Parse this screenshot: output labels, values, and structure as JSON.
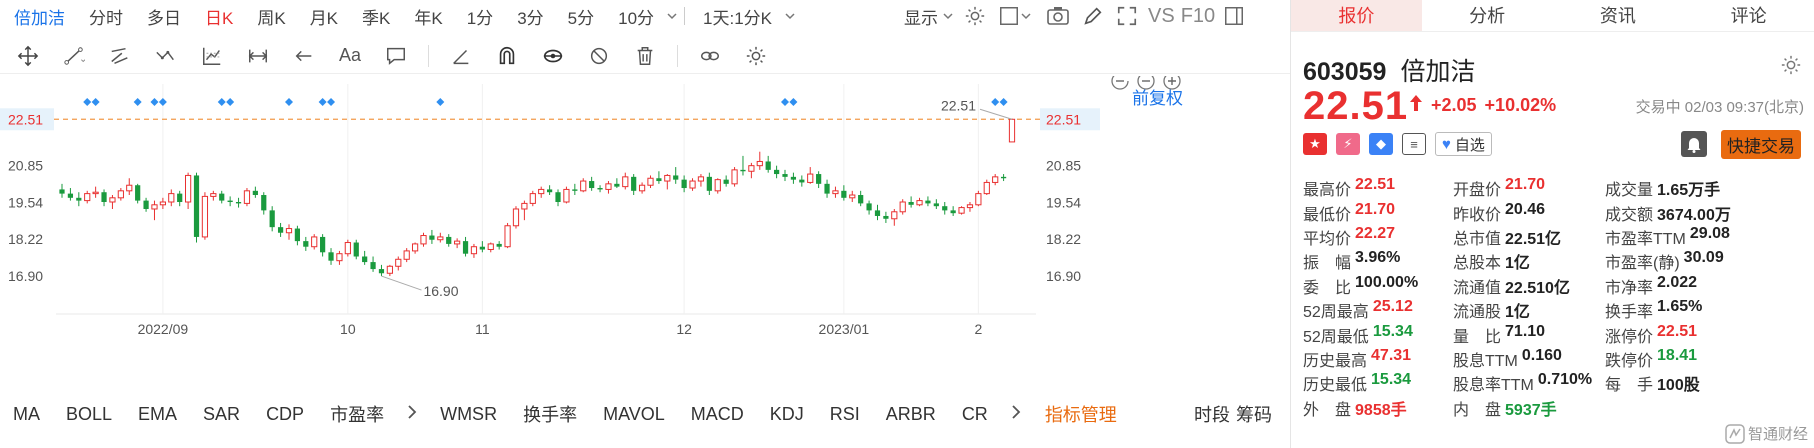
{
  "periods": [
    "倍加洁",
    "分时",
    "多日",
    "日K",
    "周K",
    "月K",
    "季K",
    "年K",
    "1分",
    "3分",
    "5分",
    "10分"
  ],
  "active_period": "日K",
  "period_dropdown": "1天:1分K",
  "display_label": "显示",
  "vs_label": "VS",
  "f10_label": "F10",
  "tools": [
    "crosshair-icon",
    "line-tool-icon",
    "channel-tool-icon",
    "wave-tool-icon",
    "fib-tool-icon",
    "range-tool-icon",
    "arrow-tool-icon",
    "text-tool-icon",
    "note-tool-icon",
    "angle-tool-icon",
    "magnet-icon",
    "eye-icon",
    "hide-icon",
    "trash-icon",
    "link-icon",
    "settings-icon"
  ],
  "text_tool_label": "Aa",
  "restore_label": "前复权",
  "chart_data": {
    "type": "candlestick",
    "title": "",
    "ylim": [
      15.9,
      23.2
    ],
    "yticks": [
      22.51,
      20.85,
      19.54,
      18.22,
      16.9
    ],
    "xticks": [
      "2022/09",
      "10",
      "11",
      "12",
      "2023/01",
      "2"
    ],
    "xtick_index": [
      12,
      34,
      50,
      74,
      93,
      109
    ],
    "current_price_line": 22.51,
    "max_label": "22.51",
    "min_label": "16.90",
    "candles": [
      [
        20.0,
        20.2,
        19.7,
        19.85
      ],
      [
        19.85,
        20.05,
        19.6,
        19.7
      ],
      [
        19.7,
        19.9,
        19.4,
        19.6
      ],
      [
        19.6,
        19.95,
        19.5,
        19.85
      ],
      [
        19.85,
        20.1,
        19.7,
        19.9
      ],
      [
        19.9,
        20.0,
        19.4,
        19.55
      ],
      [
        19.55,
        19.8,
        19.3,
        19.7
      ],
      [
        19.7,
        20.05,
        19.6,
        19.95
      ],
      [
        19.95,
        20.4,
        19.8,
        20.15
      ],
      [
        20.15,
        20.2,
        19.5,
        19.6
      ],
      [
        19.6,
        19.7,
        19.2,
        19.3
      ],
      [
        19.3,
        19.6,
        18.9,
        19.45
      ],
      [
        19.45,
        19.7,
        19.3,
        19.55
      ],
      [
        19.55,
        20.0,
        19.4,
        19.85
      ],
      [
        19.85,
        19.95,
        19.4,
        19.55
      ],
      [
        19.55,
        20.6,
        19.3,
        20.5
      ],
      [
        20.5,
        20.6,
        18.1,
        18.3
      ],
      [
        18.3,
        19.9,
        18.2,
        19.75
      ],
      [
        19.75,
        19.95,
        19.6,
        19.85
      ],
      [
        19.85,
        19.95,
        19.5,
        19.6
      ],
      [
        19.6,
        19.75,
        19.4,
        19.55
      ],
      [
        19.55,
        19.7,
        19.35,
        19.5
      ],
      [
        19.5,
        20.05,
        19.4,
        19.95
      ],
      [
        19.95,
        20.1,
        19.7,
        19.8
      ],
      [
        19.8,
        19.9,
        19.1,
        19.25
      ],
      [
        19.25,
        19.4,
        18.5,
        18.65
      ],
      [
        18.65,
        18.8,
        18.3,
        18.45
      ],
      [
        18.45,
        18.75,
        18.2,
        18.6
      ],
      [
        18.6,
        18.7,
        18.0,
        18.15
      ],
      [
        18.15,
        18.3,
        17.8,
        17.95
      ],
      [
        17.95,
        18.4,
        17.85,
        18.3
      ],
      [
        18.3,
        18.4,
        17.6,
        17.75
      ],
      [
        17.75,
        17.9,
        17.3,
        17.45
      ],
      [
        17.45,
        17.8,
        17.3,
        17.7
      ],
      [
        17.7,
        18.2,
        17.6,
        18.1
      ],
      [
        18.1,
        18.2,
        17.5,
        17.6
      ],
      [
        17.6,
        17.8,
        17.3,
        17.4
      ],
      [
        17.4,
        17.6,
        17.05,
        17.15
      ],
      [
        17.15,
        17.3,
        16.9,
        17.0
      ],
      [
        17.0,
        17.3,
        16.9,
        17.25
      ],
      [
        17.25,
        17.6,
        17.1,
        17.5
      ],
      [
        17.5,
        17.9,
        17.4,
        17.8
      ],
      [
        17.8,
        18.1,
        17.7,
        18.05
      ],
      [
        18.05,
        18.45,
        17.95,
        18.35
      ],
      [
        18.35,
        18.55,
        18.05,
        18.2
      ],
      [
        18.2,
        18.45,
        18.1,
        18.3
      ],
      [
        18.3,
        18.4,
        17.95,
        18.05
      ],
      [
        18.05,
        18.25,
        17.9,
        18.15
      ],
      [
        18.15,
        18.3,
        17.6,
        17.7
      ],
      [
        17.7,
        18.05,
        17.55,
        17.95
      ],
      [
        17.95,
        18.15,
        17.75,
        17.85
      ],
      [
        17.85,
        18.1,
        17.75,
        18.05
      ],
      [
        18.05,
        18.15,
        17.85,
        17.95
      ],
      [
        17.95,
        18.8,
        17.9,
        18.7
      ],
      [
        18.7,
        19.4,
        18.6,
        19.3
      ],
      [
        19.3,
        19.6,
        18.9,
        19.5
      ],
      [
        19.5,
        19.95,
        19.4,
        19.85
      ],
      [
        19.85,
        20.1,
        19.7,
        20.0
      ],
      [
        20.0,
        20.15,
        19.8,
        19.9
      ],
      [
        19.9,
        20.0,
        19.4,
        19.55
      ],
      [
        19.55,
        20.1,
        19.5,
        20.0
      ],
      [
        20.0,
        20.2,
        19.8,
        19.95
      ],
      [
        19.95,
        20.4,
        19.9,
        20.3
      ],
      [
        20.3,
        20.45,
        19.95,
        20.05
      ],
      [
        20.05,
        20.15,
        19.9,
        20.0
      ],
      [
        20.0,
        20.3,
        19.85,
        20.2
      ],
      [
        20.2,
        20.4,
        20.05,
        20.1
      ],
      [
        20.1,
        20.6,
        20.0,
        20.45
      ],
      [
        20.45,
        20.55,
        19.8,
        19.95
      ],
      [
        19.95,
        20.25,
        19.85,
        20.15
      ],
      [
        20.15,
        20.5,
        20.05,
        20.4
      ],
      [
        20.4,
        20.65,
        20.2,
        20.3
      ],
      [
        20.3,
        20.55,
        20.0,
        20.5
      ],
      [
        20.5,
        20.8,
        20.2,
        20.35
      ],
      [
        20.35,
        20.5,
        19.9,
        20.05
      ],
      [
        20.05,
        20.4,
        19.95,
        20.3
      ],
      [
        20.3,
        20.55,
        20.1,
        20.45
      ],
      [
        20.45,
        20.6,
        19.8,
        19.95
      ],
      [
        19.95,
        20.4,
        19.85,
        20.35
      ],
      [
        20.35,
        20.5,
        20.1,
        20.2
      ],
      [
        20.2,
        20.8,
        20.1,
        20.7
      ],
      [
        20.7,
        21.2,
        20.5,
        20.65
      ],
      [
        20.65,
        20.95,
        20.4,
        20.85
      ],
      [
        20.85,
        21.35,
        20.7,
        21.0
      ],
      [
        21.0,
        21.2,
        20.6,
        20.7
      ],
      [
        20.7,
        20.85,
        20.4,
        20.55
      ],
      [
        20.55,
        20.7,
        20.3,
        20.45
      ],
      [
        20.45,
        20.6,
        20.2,
        20.35
      ],
      [
        20.35,
        20.5,
        20.1,
        20.25
      ],
      [
        20.25,
        20.8,
        20.2,
        20.55
      ],
      [
        20.55,
        20.65,
        20.05,
        20.2
      ],
      [
        20.2,
        20.35,
        19.7,
        19.85
      ],
      [
        19.85,
        20.1,
        19.7,
        19.95
      ],
      [
        19.95,
        20.15,
        19.6,
        19.7
      ],
      [
        19.7,
        19.95,
        19.55,
        19.8
      ],
      [
        19.8,
        19.95,
        19.4,
        19.5
      ],
      [
        19.5,
        19.6,
        19.1,
        19.25
      ],
      [
        19.25,
        19.45,
        18.9,
        19.05
      ],
      [
        19.05,
        19.2,
        18.8,
        18.95
      ],
      [
        18.95,
        19.3,
        18.7,
        19.2
      ],
      [
        19.2,
        19.65,
        19.1,
        19.55
      ],
      [
        19.55,
        19.75,
        19.35,
        19.45
      ],
      [
        19.45,
        19.7,
        19.4,
        19.6
      ],
      [
        19.6,
        19.75,
        19.4,
        19.5
      ],
      [
        19.5,
        19.65,
        19.3,
        19.4
      ],
      [
        19.4,
        19.55,
        19.1,
        19.25
      ],
      [
        19.25,
        19.4,
        19.05,
        19.15
      ],
      [
        19.15,
        19.4,
        19.1,
        19.35
      ],
      [
        19.35,
        19.55,
        19.2,
        19.45
      ],
      [
        19.45,
        19.95,
        19.4,
        19.85
      ],
      [
        19.85,
        20.35,
        19.8,
        20.25
      ],
      [
        20.25,
        20.55,
        20.15,
        20.45
      ],
      [
        20.45,
        20.55,
        20.3,
        20.4
      ],
      [
        21.7,
        22.51,
        21.7,
        22.51
      ]
    ],
    "event_markers_index": [
      3,
      4,
      9,
      11,
      12,
      19,
      20,
      27,
      31,
      32,
      45,
      86,
      87,
      111,
      112
    ],
    "up_color": "#e93030",
    "down_color": "#1a9a3e"
  },
  "indicators": [
    "MA",
    "BOLL",
    "EMA",
    "SAR",
    "CDP",
    "市盈率",
    "WMSR",
    "换手率",
    "MAVOL",
    "MACD",
    "KDJ",
    "RSI",
    "ARBR",
    "CR"
  ],
  "indicator_manager": "指标管理",
  "indicator_right": [
    "时段",
    "筹码"
  ],
  "panel": {
    "tabs": [
      "报价",
      "分析",
      "资讯",
      "评论"
    ],
    "active_tab": "报价",
    "code": "603059",
    "name": "倍加洁",
    "price": "22.51",
    "change": "+2.05",
    "change_pct": "+10.02%",
    "trade_status": "交易中 02/03 09:37(北京)",
    "watchlist_label": "自选",
    "quick_trade_label": "快捷交易",
    "rows": [
      [
        [
          "最高价",
          "22.51",
          "red"
        ],
        [
          "开盘价",
          "21.70",
          "red"
        ],
        [
          "成交量",
          "1.65万手",
          "dark"
        ]
      ],
      [
        [
          "最低价",
          "21.70",
          "red"
        ],
        [
          "昨收价",
          "20.46",
          "dark"
        ],
        [
          "成交额",
          "3674.00万",
          "dark"
        ]
      ],
      [
        [
          "平均价",
          "22.27",
          "red"
        ],
        [
          "总市值",
          "22.51亿",
          "dark"
        ],
        [
          "市盈率TTM",
          "29.08",
          "dark"
        ]
      ],
      [
        [
          "振　幅",
          "3.96%",
          "dark"
        ],
        [
          "总股本",
          "1亿",
          "dark"
        ],
        [
          "市盈率(静)",
          "30.09",
          "dark"
        ]
      ],
      [
        [
          "委　比",
          "100.00%",
          "dark"
        ],
        [
          "流通值",
          "22.510亿",
          "dark"
        ],
        [
          "市净率",
          "2.022",
          "dark"
        ]
      ],
      [
        [
          "52周最高",
          "25.12",
          "red"
        ],
        [
          "流通股",
          "1亿",
          "dark"
        ],
        [
          "换手率",
          "1.65%",
          "dark"
        ]
      ],
      [
        [
          "52周最低",
          "15.34",
          "green"
        ],
        [
          "量　比",
          "71.10",
          "dark"
        ],
        [
          "涨停价",
          "22.51",
          "red"
        ]
      ],
      [
        [
          "历史最高",
          "47.31",
          "red"
        ],
        [
          "股息TTM",
          "0.160",
          "dark"
        ],
        [
          "跌停价",
          "18.41",
          "green"
        ]
      ],
      [
        [
          "历史最低",
          "15.34",
          "green"
        ],
        [
          "股息率TTM",
          "0.710%",
          "dark"
        ],
        [
          "每　手",
          "100股",
          "dark"
        ]
      ],
      [
        [
          "外　盘",
          "9858手",
          "red"
        ],
        [
          "内　盘",
          "5937手",
          "green"
        ],
        [
          "",
          "",
          " dark"
        ]
      ]
    ],
    "watermark": "智通财经"
  }
}
